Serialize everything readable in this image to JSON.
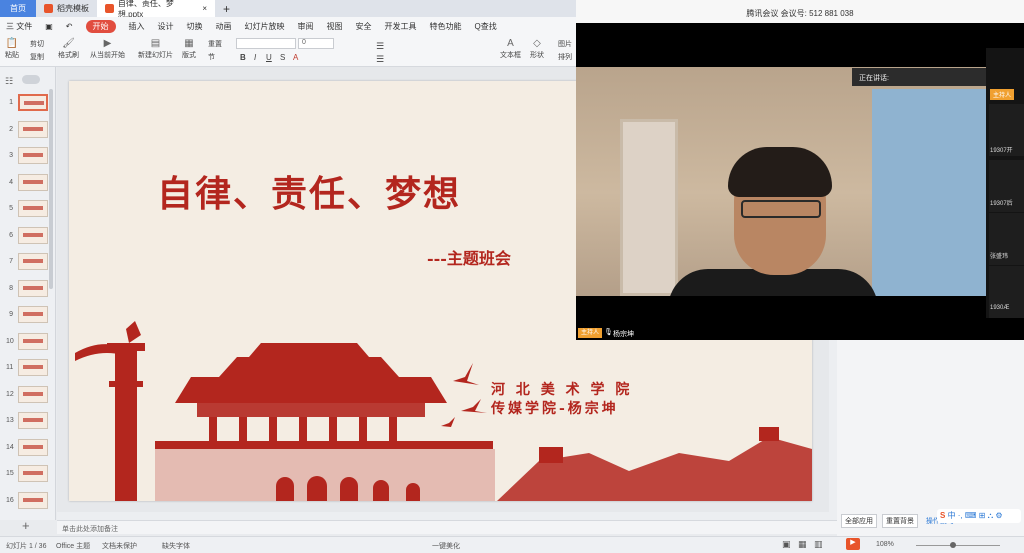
{
  "tabs": {
    "home": "首页",
    "template": "稻壳模板",
    "doc": "自律、责任、梦想.pptx"
  },
  "menu": {
    "file": "三 文件",
    "start": "开始",
    "insert": "插入",
    "design": "设计",
    "transition": "切换",
    "animation": "动画",
    "slideshow": "幻灯片放映",
    "review": "审阅",
    "view": "视图",
    "security": "安全",
    "devtools": "开发工具",
    "special": "特色功能",
    "search": "Q查找"
  },
  "ribbon": {
    "paste": "粘贴",
    "cut": "剪切",
    "copy": "复制",
    "format_painter": "格式刷",
    "play_from_current": "从当前开始",
    "new_slide": "新建幻灯片",
    "layout": "版式",
    "section": "节",
    "reset": "重置",
    "font_size_value": "0",
    "textbox": "文本框",
    "shape": "形状",
    "picture": "图片",
    "arrange": "排列"
  },
  "thumbnails": [
    "1",
    "2",
    "3",
    "4",
    "5",
    "6",
    "7",
    "8",
    "9",
    "10",
    "11",
    "12",
    "13",
    "14",
    "15",
    "16"
  ],
  "slide": {
    "title": "自律、责任、梦想",
    "subtitle": "---主题班会",
    "school_line1": "河 北 美 术 学 院",
    "school_line2": "传媒学院-杨宗坤"
  },
  "notes_placeholder": "单击此处添加备注",
  "status": {
    "slide_count": "幻灯片 1 / 36",
    "theme": "Office 主题",
    "doc_protect": "文档未保护",
    "missing_font": "缺失字体",
    "beautify": "一键美化",
    "zoom": "108%"
  },
  "right_pane": {
    "apply_all": "全部应用",
    "reset_bg": "重置背景",
    "more": "操作技巧"
  },
  "meeting": {
    "title": "腾讯会议 会议号: 512 881 038",
    "speaking": "正在讲话:",
    "host_badge": "主持人",
    "host_name": "杨宗坤",
    "participants": [
      "19307开",
      "19307后",
      "张盛玮",
      "1930Æ"
    ]
  },
  "ime": {
    "logo": "S",
    "text": "中 ·, ⌨ ⊞ ⛬ ⚙"
  }
}
